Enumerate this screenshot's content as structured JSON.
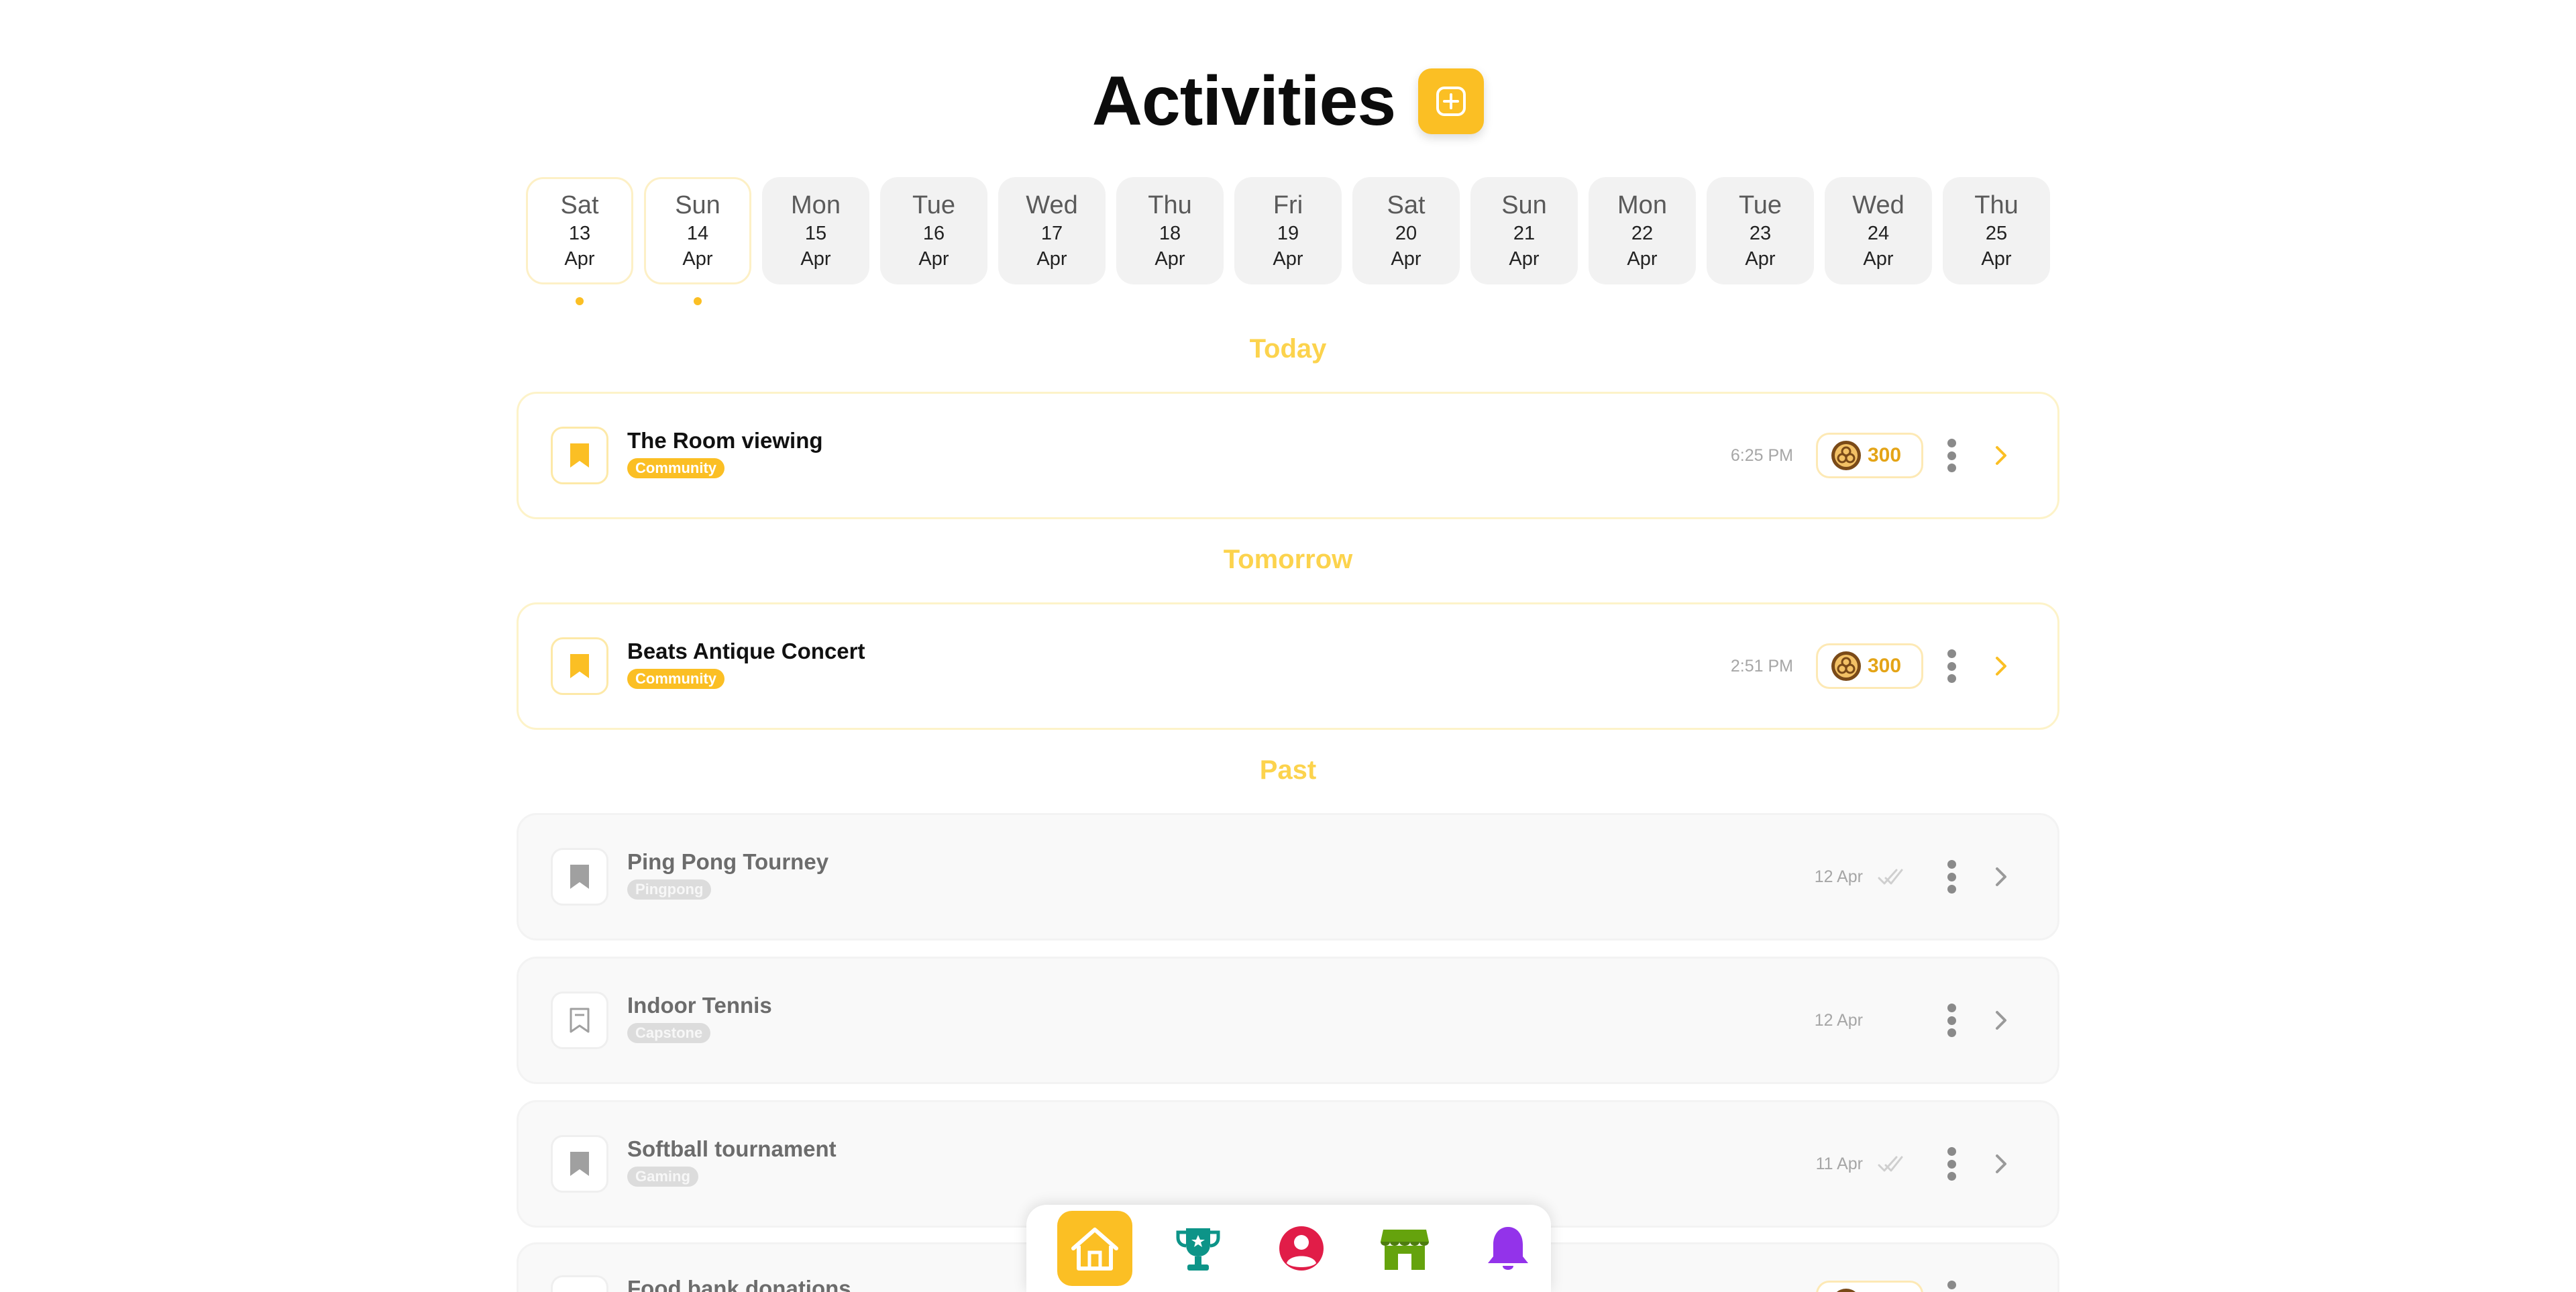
{
  "header": {
    "title": "Activities",
    "add_icon": "plus-square-icon"
  },
  "dates": [
    {
      "day": "Sat",
      "num": "13",
      "month": "Apr",
      "has_event": true
    },
    {
      "day": "Sun",
      "num": "14",
      "month": "Apr",
      "has_event": true
    },
    {
      "day": "Mon",
      "num": "15",
      "month": "Apr",
      "has_event": false
    },
    {
      "day": "Tue",
      "num": "16",
      "month": "Apr",
      "has_event": false
    },
    {
      "day": "Wed",
      "num": "17",
      "month": "Apr",
      "has_event": false
    },
    {
      "day": "Thu",
      "num": "18",
      "month": "Apr",
      "has_event": false
    },
    {
      "day": "Fri",
      "num": "19",
      "month": "Apr",
      "has_event": false
    },
    {
      "day": "Sat",
      "num": "20",
      "month": "Apr",
      "has_event": false
    },
    {
      "day": "Sun",
      "num": "21",
      "month": "Apr",
      "has_event": false
    },
    {
      "day": "Mon",
      "num": "22",
      "month": "Apr",
      "has_event": false
    },
    {
      "day": "Tue",
      "num": "23",
      "month": "Apr",
      "has_event": false
    },
    {
      "day": "Wed",
      "num": "24",
      "month": "Apr",
      "has_event": false
    },
    {
      "day": "Thu",
      "num": "25",
      "month": "Apr",
      "has_event": false
    }
  ],
  "sections": {
    "today": "Today",
    "tomorrow": "Tomorrow",
    "past": "Past"
  },
  "events": {
    "today": [
      {
        "title": "The Room viewing",
        "tag": "Community",
        "time": "6:25 PM",
        "points": "300"
      }
    ],
    "tomorrow": [
      {
        "title": "Beats Antique Concert",
        "tag": "Community",
        "time": "2:51 PM",
        "points": "300"
      }
    ],
    "past": [
      {
        "title": "Ping Pong Tourney",
        "tag": "Pingpong",
        "date": "12 Apr",
        "completed": true
      },
      {
        "title": "Indoor Tennis",
        "tag": "Capstone",
        "date": "12 Apr",
        "completed": false
      },
      {
        "title": "Softball tournament",
        "tag": "Gaming",
        "date": "11 Apr",
        "completed": true
      },
      {
        "title": "Food bank donations",
        "tag": "",
        "date": "",
        "completed": false
      }
    ]
  },
  "bottom_nav": [
    {
      "name": "home-icon",
      "active": true
    },
    {
      "name": "trophy-icon",
      "active": false
    },
    {
      "name": "profile-icon",
      "active": false
    },
    {
      "name": "store-icon",
      "active": false
    },
    {
      "name": "bell-icon",
      "active": false
    }
  ],
  "colors": {
    "accent": "#fbbf24",
    "section_label": "#fcd34d",
    "trophy": "#0d9488",
    "profile": "#e11d48",
    "store": "#65a30d",
    "bell": "#9333ea"
  }
}
